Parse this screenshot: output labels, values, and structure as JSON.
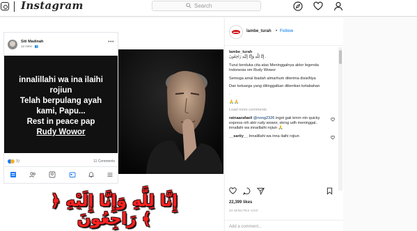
{
  "topbar": {
    "brand": "Instagram",
    "search_placeholder": "Search",
    "icons": [
      "compass-icon",
      "heart-icon",
      "person-icon"
    ]
  },
  "post_image": {
    "fb_card": {
      "name": "Siti Madinah",
      "time": "12 mins · 👥",
      "lines": [
        "innalillahi wa ina ilaihi",
        "rojiun",
        "Telah berpulang ayah",
        "kami, Papu...",
        "Rest in peace pap",
        "Rudy Wowor"
      ],
      "reaction_count": "70",
      "comments": "11 Comments",
      "tabs": [
        "news-feed-icon",
        "friends-icon",
        "profile-icon",
        "groups-icon",
        "notifications-icon",
        "menu-icon"
      ]
    },
    "arabic_text": "﴿ إِنَّا لِلَّهِ وَإِنَّا إِلَيْهِ رَاجِعُونَ ﴾"
  },
  "side": {
    "handle": "lambe_turah",
    "dot": "•",
    "follow": "Follow",
    "caption": {
      "user": "lambe_turah",
      "arabic": "إِنَّا لِلَّهِ وَإِنَّا إِلَيْهِ رَاجِعُونَ .",
      "p1": "Turut berduka cita atas Meninggalnya aktor legenda Indonesia om Rudy Wowor",
      "p2": "Semoga amal ibadah almarhum diterima disisiNya",
      "p3": "Dan keluarga yang ditinggalkan diberikan ketabahan",
      "p4": ".",
      "emoji": "🙏🙏",
      "load_more": "Load more comments",
      "c1_user": "ratnaarafaeil",
      "c1_tag": "@nong2326",
      "c1_text": "inget gak kmrn ntn quicky express nih aktr rudy wowor, skrng udh meninggal.. innallahi wa innaillaihi rojiun 🙏",
      "c2_user": "__sariiy__",
      "c2_text": "Innalillahi wa inna ilaihi rojiun"
    },
    "likes": "22,399 likes",
    "ago": "34 MINUTES AGO",
    "add_comment": "Add a comment..."
  },
  "colors": {
    "accent": "#3897f0",
    "arabic": "#ff2020",
    "fb_blue": "#1877f2"
  }
}
